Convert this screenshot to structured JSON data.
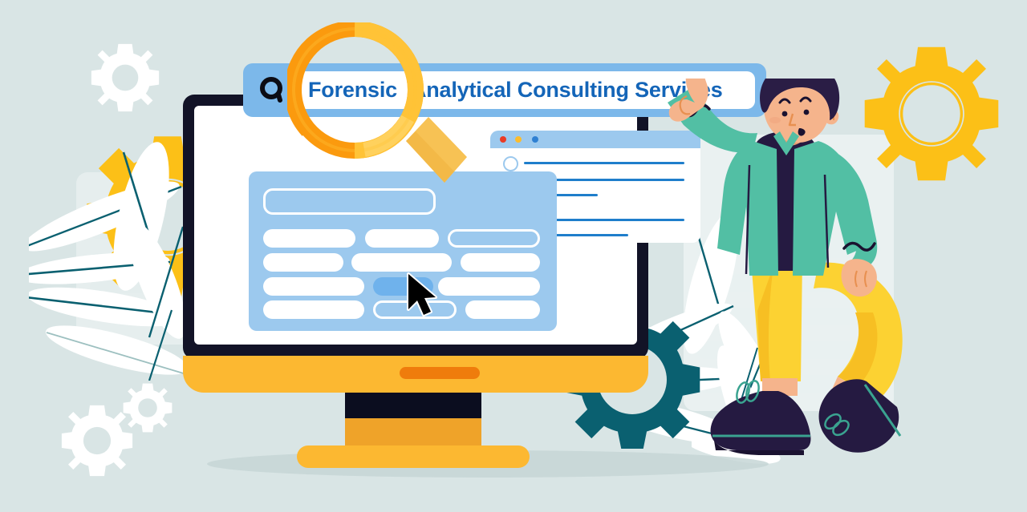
{
  "illustration": {
    "title": "Forensic Analytical Consulting Services search illustration",
    "background_color": "#d9e5e5"
  },
  "search": {
    "query_part_1": "Forensic",
    "query_part_2": "Analytical Consulting Services",
    "full_query": "Forensic Analytical Consulting Services",
    "text_color": "#1465b8",
    "bar_color": "#7cb8ea",
    "field_color": "#ffffff",
    "icon": "search-icon"
  },
  "magnifier": {
    "icon": "magnifying-glass-icon",
    "ring_color": "#ffc337",
    "shade_color": "#fb9a0e",
    "handle_color": "#f7c254"
  },
  "monitor": {
    "label": "desktop-monitor",
    "bezel_color": "#121327",
    "screen_color": "#ffffff",
    "chin_color": "#fcb831",
    "button_color": "#ef7c0c",
    "stand_color": "#efa329",
    "base_color": "#fcb831"
  },
  "form_card": {
    "label": "form-card",
    "card_color": "#9cc9ee",
    "field_color": "#ffffff",
    "selected_field_color": "#6fb2ec",
    "header_field": "header-field",
    "rows": [
      {
        "fields": [
          "filled",
          "filled",
          "outline"
        ]
      },
      {
        "fields": [
          "filled",
          "filled",
          "filled"
        ]
      },
      {
        "fields": [
          "filled",
          "selected",
          "filled"
        ]
      },
      {
        "fields": [
          "filled",
          "outline",
          "filled"
        ]
      }
    ]
  },
  "cursor": {
    "label": "mouse-pointer",
    "color": "#000000"
  },
  "browser_window": {
    "label": "browser-window",
    "titlebar_color": "#9cc9ee",
    "dots": [
      {
        "name": "close-dot",
        "color": "#ea3b26"
      },
      {
        "name": "minimize-dot",
        "color": "#fcbc2c"
      },
      {
        "name": "maximize-dot",
        "color": "#2f80d2"
      }
    ],
    "line_color": "#1f7ecb",
    "line_count": 6
  },
  "character": {
    "label": "person-pointing",
    "jacket_color": "#52bfa4",
    "shirt_color": "#251a41",
    "pants_color": "#fcd232",
    "hair_color": "#2a1d45",
    "skin_color": "#f5b48c",
    "shoe_color": "#251a41",
    "lace_color": "#3aa390",
    "gesture": "pointing-up-at-search-bar"
  },
  "gears": [
    {
      "name": "gear-top-left-white",
      "color": "#ffffff",
      "teeth": 8
    },
    {
      "name": "gear-left-yellow",
      "color": "#fcc017",
      "teeth": 10
    },
    {
      "name": "gear-bottom-left-white-large",
      "color": "#ffffff",
      "teeth": 8
    },
    {
      "name": "gear-bottom-left-white-small",
      "color": "#ffffff",
      "teeth": 8
    },
    {
      "name": "gear-bottom-center-teal",
      "color": "#0a6070",
      "teeth": 12
    },
    {
      "name": "gear-top-right-yellow",
      "color": "#fcc017",
      "teeth": 8
    }
  ],
  "foliage": {
    "label": "decorative-leaves",
    "leaf_color": "#ffffff",
    "vein_color": "#0a6070"
  }
}
